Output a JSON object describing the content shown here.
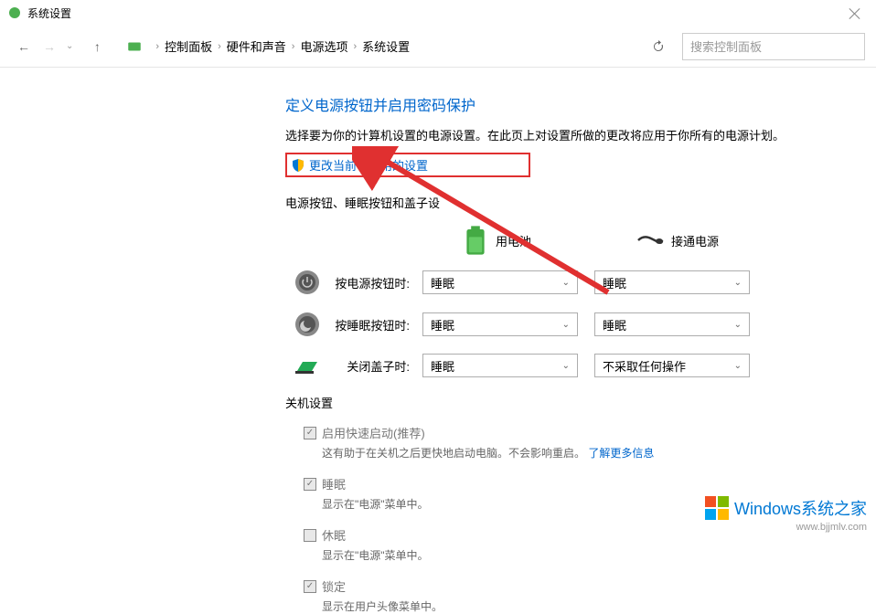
{
  "window": {
    "title": "系统设置"
  },
  "breadcrumb": {
    "items": [
      "控制面板",
      "硬件和声音",
      "电源选项",
      "系统设置"
    ]
  },
  "search": {
    "placeholder": "搜索控制面板"
  },
  "page": {
    "title": "定义电源按钮并启用密码保护",
    "description": "选择要为你的计算机设置的电源设置。在此页上对设置所做的更改将应用于你所有的电源计划。",
    "change_link": "更改当前不可用的设置"
  },
  "sections": {
    "buttons_label": "电源按钮、睡眠按钮和盖子设"
  },
  "columns": {
    "battery": "用电池",
    "plugged": "接通电源"
  },
  "settings": [
    {
      "label": "按电源按钮时:",
      "battery_value": "睡眠",
      "plugged_value": "睡眠"
    },
    {
      "label": "按睡眠按钮时:",
      "battery_value": "睡眠",
      "plugged_value": "睡眠"
    },
    {
      "label": "关闭盖子时:",
      "battery_value": "睡眠",
      "plugged_value": "不采取任何操作"
    }
  ],
  "shutdown": {
    "title": "关机设置",
    "items": [
      {
        "label": "启用快速启动(推荐)",
        "checked": true,
        "desc": "这有助于在关机之后更快地启动电脑。不会影响重启。",
        "link": "了解更多信息"
      },
      {
        "label": "睡眠",
        "checked": true,
        "desc": "显示在\"电源\"菜单中。"
      },
      {
        "label": "休眠",
        "checked": false,
        "desc": "显示在\"电源\"菜单中。"
      },
      {
        "label": "锁定",
        "checked": true,
        "desc": "显示在用户头像菜单中。"
      }
    ]
  },
  "watermark": {
    "text": "Windows系统之家",
    "url": "www.bjjmlv.com"
  }
}
